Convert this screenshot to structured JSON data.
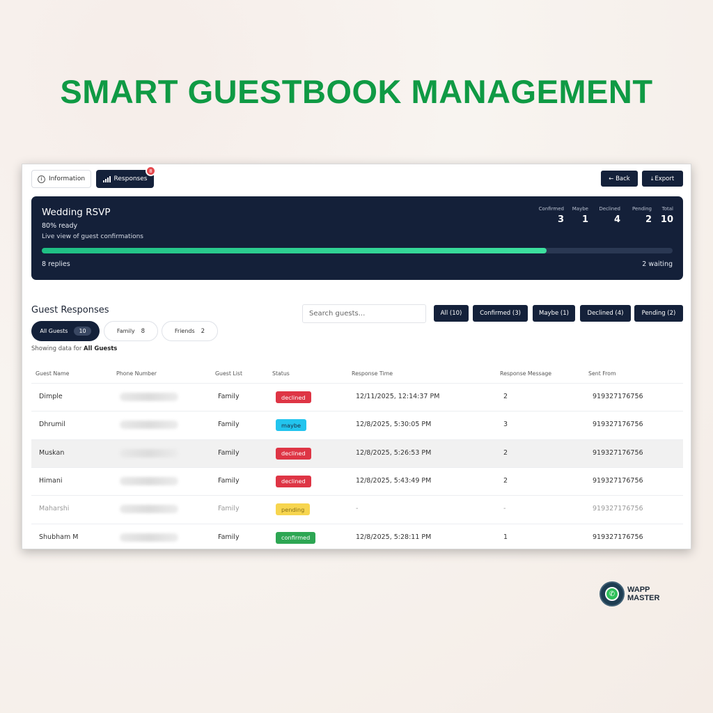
{
  "headline": "SMART GUESTBOOK MANAGEMENT",
  "tabs": {
    "information": "Information",
    "responses": "Responses",
    "responses_badge": "8"
  },
  "actions": {
    "back": "← Back",
    "export": "Export"
  },
  "hero": {
    "title": "Wedding RSVP",
    "ready": "80% ready",
    "subtitle": "Live view of guest confirmations",
    "progress_percent": 80,
    "replies": "8 replies",
    "waiting": "2 waiting",
    "stats": [
      {
        "label": "Confirmed",
        "value": "3"
      },
      {
        "label": "Maybe",
        "value": "1"
      },
      {
        "label": "Declined",
        "value": "4"
      },
      {
        "label": "Pending",
        "value": "2"
      },
      {
        "label": "Total",
        "value": "10"
      }
    ]
  },
  "guests": {
    "title": "Guest Responses",
    "search_placeholder": "Search guests...",
    "filters": [
      "All (10)",
      "Confirmed (3)",
      "Maybe (1)",
      "Declined (4)",
      "Pending (2)"
    ],
    "lists": [
      {
        "label": "All Guests",
        "count": "10"
      },
      {
        "label": "Family",
        "count": "8"
      },
      {
        "label": "Friends",
        "count": "2"
      }
    ],
    "showing_prefix": "Showing data for ",
    "showing_value": "All Guests"
  },
  "table": {
    "headers": [
      "Guest Name",
      "Phone Number",
      "Guest List",
      "Status",
      "Response Time",
      "Response Message",
      "Sent From"
    ],
    "rows": [
      {
        "name": "Dimple",
        "list": "Family",
        "status": "declined",
        "time": "12/11/2025, 12:14:37 PM",
        "message": "2",
        "sent_from": "919327176756"
      },
      {
        "name": "Dhrumil",
        "list": "Family",
        "status": "maybe",
        "time": "12/8/2025, 5:30:05 PM",
        "message": "3",
        "sent_from": "919327176756"
      },
      {
        "name": "Muskan",
        "list": "Family",
        "status": "declined",
        "time": "12/8/2025, 5:26:53 PM",
        "message": "2",
        "sent_from": "919327176756"
      },
      {
        "name": "Himani",
        "list": "Family",
        "status": "declined",
        "time": "12/8/2025, 5:43:49 PM",
        "message": "2",
        "sent_from": "919327176756"
      },
      {
        "name": "Maharshi",
        "list": "Family",
        "status": "pending",
        "time": "-",
        "message": "-",
        "sent_from": "919327176756"
      },
      {
        "name": "Shubham M",
        "list": "Family",
        "status": "confirmed",
        "time": "12/8/2025, 5:28:11 PM",
        "message": "1",
        "sent_from": "919327176756"
      }
    ]
  },
  "logo": {
    "line1": "WAPP",
    "line2": "MASTER"
  },
  "colors": {
    "headline": "#0f9a44",
    "navy": "#14213a",
    "progress": "#2fd392",
    "declined": "#de3545",
    "maybe": "#22c4ee",
    "pending": "#f7d54f",
    "confirmed": "#2da653"
  }
}
